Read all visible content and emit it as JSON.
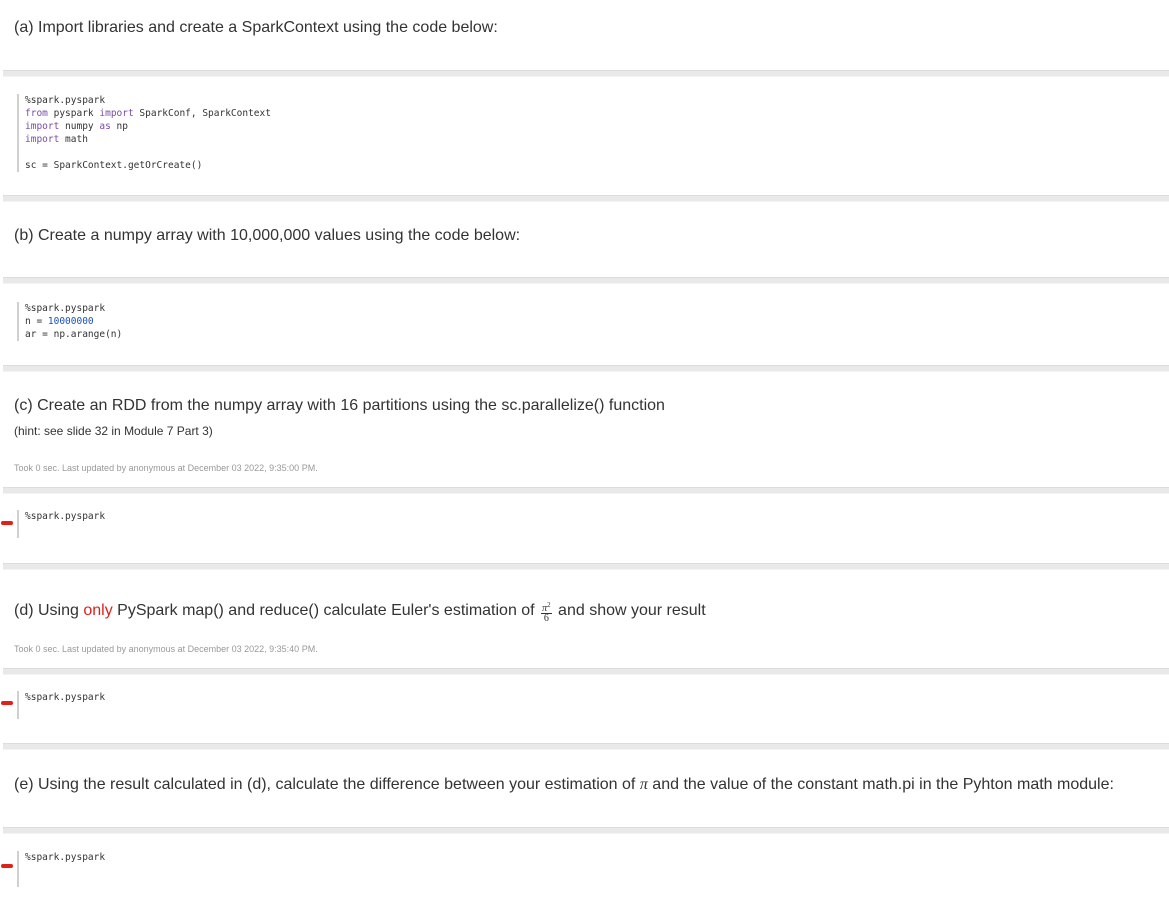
{
  "sections": {
    "a": {
      "text": "(a) Import libraries and create a SparkContext using the code below:",
      "code": {
        "l1": "%spark.pyspark",
        "l2_kw1": "from",
        "l2_mod": " pyspark ",
        "l2_kw2": "import",
        "l2_rest": " SparkConf, SparkContext",
        "l3_kw1": "import",
        "l3_mod": " numpy ",
        "l3_kw2": "as",
        "l3_rest": " np",
        "l4_kw": "import",
        "l4_rest": " math",
        "l6": "sc = SparkContext.getOrCreate()"
      }
    },
    "b": {
      "text": "(b) Create a numpy array with 10,000,000 values using the code below:",
      "code": {
        "l1": "%spark.pyspark",
        "l2_pre": "n = ",
        "l2_num": "10000000",
        "l3": "ar = np.arange(n)"
      }
    },
    "c": {
      "text": "(c) Create an RDD from the numpy array with 16 partitions using the sc.parallelize() function",
      "hint": "(hint: see slide 32 in Module 7 Part 3)",
      "status": "Took 0 sec. Last updated by anonymous at December 03 2022, 9:35:00 PM.",
      "code": "%spark.pyspark"
    },
    "d": {
      "text_pre": "(d) Using ",
      "text_only": "only",
      "text_mid": " PySpark map() and reduce() calculate Euler's estimation of",
      "frac_num": "π",
      "frac_exp": "2",
      "frac_den": "6",
      "text_post": "and show your result",
      "status": "Took 0 sec. Last updated by anonymous at December 03 2022, 9:35:40 PM.",
      "code": "%spark.pyspark"
    },
    "e": {
      "text_pre": "(e) Using the result calculated in (d), calculate the difference between your estimation of",
      "pi": "π",
      "text_post": "and the value of the constant math.pi in the Pyhton math module:",
      "code": "%spark.pyspark"
    }
  }
}
